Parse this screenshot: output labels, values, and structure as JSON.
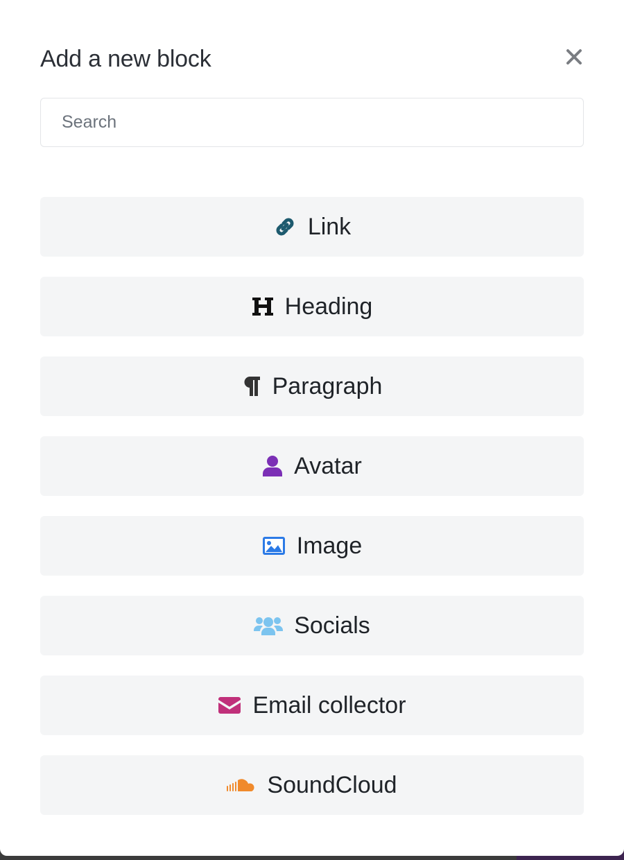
{
  "modal": {
    "title": "Add a new block",
    "close_icon": "close-icon"
  },
  "search": {
    "placeholder": "Search",
    "value": ""
  },
  "blocks": [
    {
      "label": "Link",
      "icon": "link-icon",
      "color": "#1d5a6e"
    },
    {
      "label": "Heading",
      "icon": "heading-icon",
      "color": "#111111"
    },
    {
      "label": "Paragraph",
      "icon": "paragraph-icon",
      "color": "#333333"
    },
    {
      "label": "Avatar",
      "icon": "user-icon",
      "color": "#7b2fb5"
    },
    {
      "label": "Image",
      "icon": "image-icon",
      "color": "#2b7ae6"
    },
    {
      "label": "Socials",
      "icon": "users-icon",
      "color": "#7cc4ef"
    },
    {
      "label": "Email collector",
      "icon": "envelope-icon",
      "color": "#c0307a"
    },
    {
      "label": "SoundCloud",
      "icon": "soundcloud-icon",
      "color": "#f08a2c"
    }
  ]
}
